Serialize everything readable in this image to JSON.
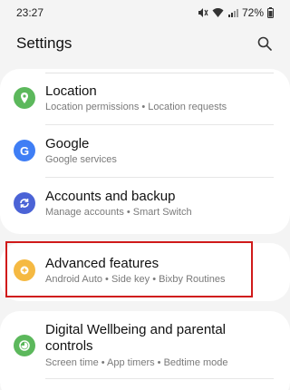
{
  "status": {
    "time": "23:27",
    "battery": "72%"
  },
  "header": {
    "title": "Settings"
  },
  "items": [
    {
      "title": "Location",
      "subtitle": "Location permissions  •  Location requests",
      "icon": "location-pin-icon",
      "color": "#5cb85c"
    },
    {
      "title": "Google",
      "subtitle": "Google services",
      "icon": "google-g-icon",
      "color": "#3f7ef5"
    },
    {
      "title": "Accounts and backup",
      "subtitle": "Manage accounts  •  Smart Switch",
      "icon": "sync-icon",
      "color": "#4b63d6"
    },
    {
      "title": "Advanced features",
      "subtitle": "Android Auto  •  Side key  •  Bixby Routines",
      "icon": "gear-plus-icon",
      "color": "#f5b942"
    },
    {
      "title_line1": "Digital Wellbeing and parental",
      "title_line2": "controls",
      "subtitle": "Screen time  •  App timers  •  Bedtime mode",
      "icon": "wellbeing-icon",
      "color": "#5cb85c"
    }
  ],
  "highlight_color": "#d01a1a"
}
